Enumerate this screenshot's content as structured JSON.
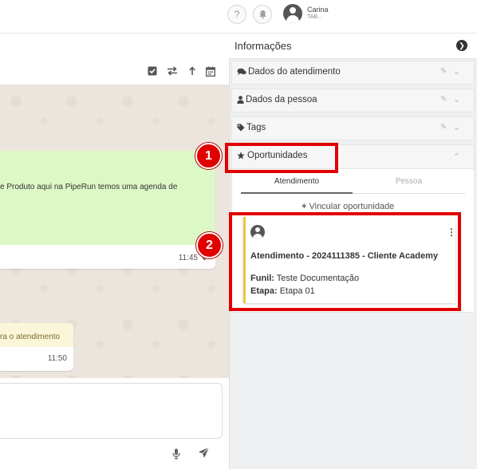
{
  "topbar": {
    "help_icon_glyph": "?",
    "bell_icon": "bell-icon",
    "user_name": "Carina",
    "user_sub": "TAB..."
  },
  "chat": {
    "toolbar_icons": [
      "check-square-icon",
      "transfer-icon",
      "upload-icon",
      "calendar-icon"
    ],
    "message_text": "e Produto aqui na PipeRun temos uma agenda de",
    "message_time": "11:45",
    "system_text": "ra o atendimento",
    "system_time": "11:50"
  },
  "panel": {
    "title": "Informações",
    "sections": [
      {
        "label": "Dados do atendimento",
        "icon": "comments-icon"
      },
      {
        "label": "Dados da pessoa",
        "icon": "user-icon"
      },
      {
        "label": "Tags",
        "icon": "tag-icon"
      },
      {
        "label": "Oportunidades",
        "icon": "star-icon"
      }
    ],
    "tabs": {
      "active": "Atendimento",
      "inactive": "Pessoa"
    },
    "link_add": "Vincular oportunidade",
    "card": {
      "title": "Atendimento - 2024111385 - Cliente Academy",
      "funil_label": "Funil:",
      "funil_value": "Teste Documentação",
      "etapa_label": "Etapa:",
      "etapa_value": "Etapa 01"
    }
  },
  "annotations": {
    "badge_1": "1",
    "badge_2": "2"
  },
  "colors": {
    "accent_annotation": "#e00000",
    "bubble_green": "#dcf8c6",
    "card_border": "#f0c53c"
  }
}
